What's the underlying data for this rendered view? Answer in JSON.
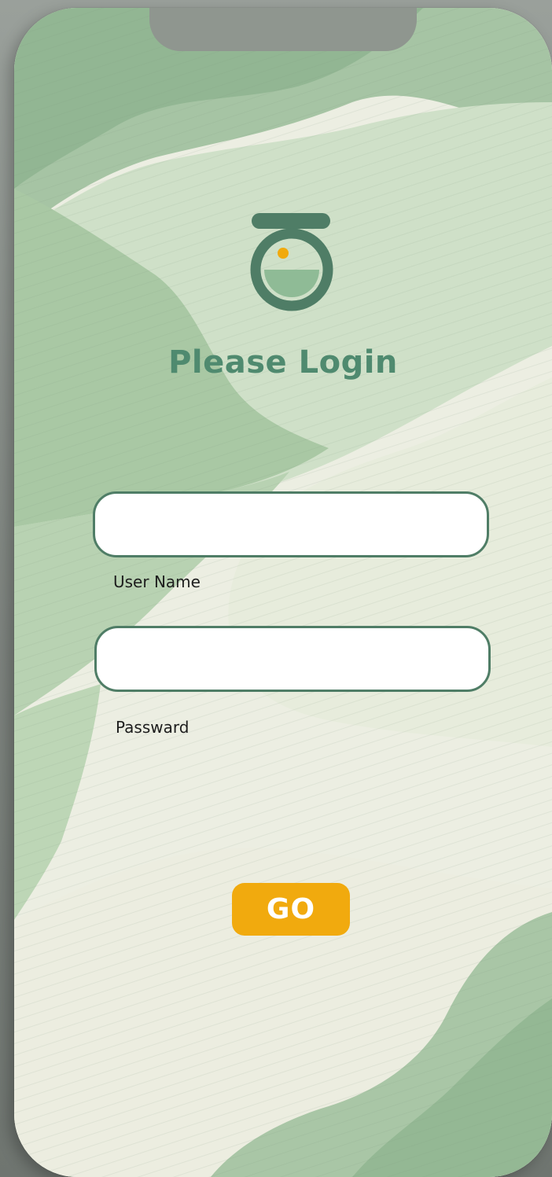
{
  "login": {
    "title": "Please Login",
    "username_label": "User Name",
    "password_label": "Passward",
    "username_value": "",
    "password_value": "",
    "submit_label": "GO"
  },
  "colors": {
    "accent_green": "#4f8a6f",
    "field_border": "#4f7d66",
    "button": "#f1aa0e",
    "logo_dot": "#f1aa0e"
  },
  "icons": {
    "logo": "cloche-bowl-logo-icon"
  }
}
